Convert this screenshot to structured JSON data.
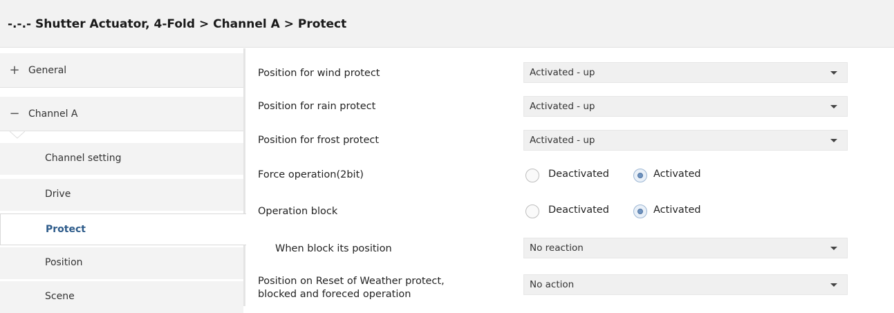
{
  "header": {
    "breadcrumb": "-.-.- Shutter Actuator, 4-Fold > Channel A > Protect"
  },
  "sidebar": {
    "general": {
      "icon": "plus-icon",
      "symbol": "+",
      "label": "General"
    },
    "channel_a": {
      "icon": "minus-icon",
      "symbol": "−",
      "label": "Channel A"
    },
    "items": [
      {
        "label": "Channel setting"
      },
      {
        "label": "Drive"
      },
      {
        "label": "Protect",
        "active": true
      },
      {
        "label": "Position"
      },
      {
        "label": "Scene"
      }
    ]
  },
  "params": {
    "wind": {
      "label": "Position for wind  protect",
      "value": "Activated - up"
    },
    "rain": {
      "label": "Position for rain  protect",
      "value": "Activated - up"
    },
    "frost": {
      "label": "Position for frost  protect",
      "value": "Activated - up"
    },
    "force": {
      "label": "Force operation(2bit)",
      "options": [
        "Deactivated",
        "Activated"
      ],
      "selected": "Activated"
    },
    "block": {
      "label": "Operation block",
      "options": [
        "Deactivated",
        "Activated"
      ],
      "selected": "Activated"
    },
    "block_position": {
      "label": "When block its position",
      "value": "No reaction"
    },
    "reset": {
      "label_line1": "Position on Reset of Weather protect,",
      "label_line2": "blocked and foreced operation",
      "value": "No action"
    }
  },
  "colors": {
    "header_bg": "#f2f2f2",
    "sidebar_bg": "#f3f3f3",
    "active_text": "#2d5b8a",
    "select_bg": "#f0f0f0",
    "radio_checked": "#6f93c0"
  }
}
